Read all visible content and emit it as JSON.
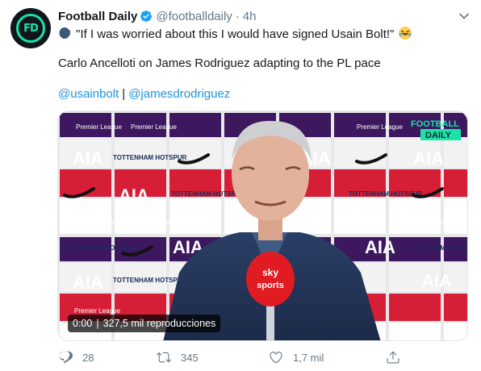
{
  "tweet": {
    "display_name": "Football Daily",
    "handle": "@footballdaily",
    "separator": "·",
    "time": "4h",
    "quote_text": "\"If I was worried about this I would have signed Usain Bolt!\"",
    "body_text": "Carlo Ancelloti on James Rodriguez adapting to the PL pace",
    "mention_1": "@usainbolt",
    "mention_sep": "|",
    "mention_2": "@jamesdrodriguez",
    "avatar_text": "FD"
  },
  "media": {
    "overlay_time": "0:00",
    "overlay_sep": "|",
    "overlay_views": "327,5 mil reproducciones",
    "watermark_line1": "FOOTBALL",
    "watermark_line2": "DAILY",
    "board_texts": [
      "Premier League",
      "AIA",
      "TOTTENHAM HOTSPUR"
    ],
    "mic_brand_1": "sky",
    "mic_brand_2": "sports"
  },
  "actions": {
    "reply_count": "28",
    "retweet_count": "345",
    "like_count": "1,7 mil",
    "share_count": ""
  },
  "icons": {
    "verified": "verified-badge-icon",
    "caret": "chevron-down-icon",
    "speaking_head": "speaking-head-emoji",
    "laughing": "rolling-on-floor-laughing-emoji",
    "reply": "reply-icon",
    "retweet": "retweet-icon",
    "like": "heart-icon",
    "share": "share-icon"
  },
  "colors": {
    "link": "#1b95e0",
    "secondary_text": "#657786",
    "verified_blue": "#1da1f2",
    "brand_green": "#19e3a7"
  }
}
